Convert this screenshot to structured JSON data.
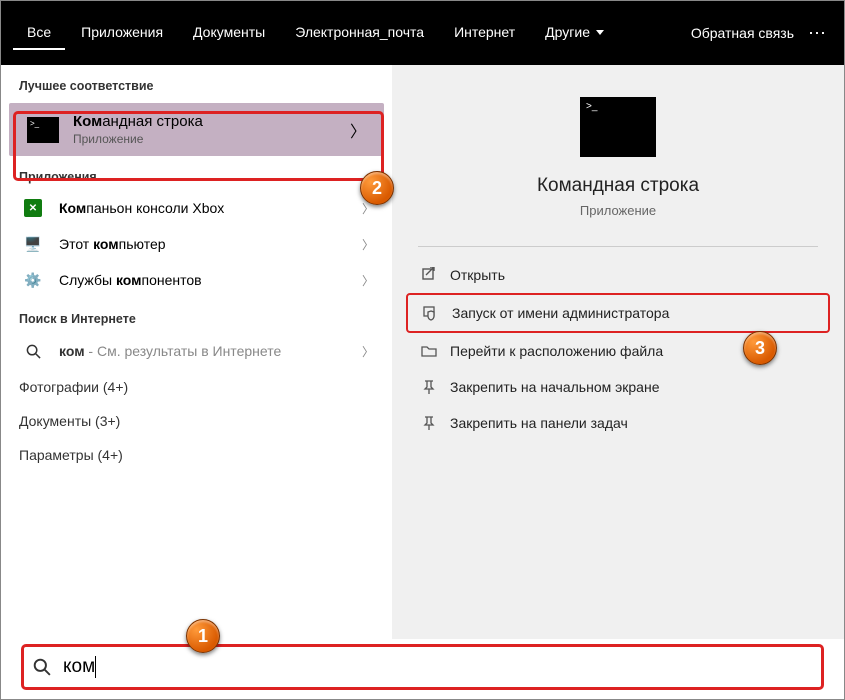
{
  "topbar": {
    "tabs": [
      "Все",
      "Приложения",
      "Документы",
      "Электронная_почта",
      "Интернет",
      "Другие"
    ],
    "active_tab": 0,
    "more_has_chevron": true,
    "feedback_label": "Обратная связь"
  },
  "results": {
    "best_header": "Лучшее соответствие",
    "best": {
      "title_bold": "Ком",
      "title_rest": "андная строка",
      "subtitle": "Приложение"
    },
    "apps_header": "Приложения",
    "apps": [
      {
        "icon": "xbox",
        "bold": "Ком",
        "rest": "паньон консоли Xbox"
      },
      {
        "icon": "pc",
        "pre": "Этот ",
        "bold": "ком",
        "post": "пьютер"
      },
      {
        "icon": "svc",
        "pre": "Службы ",
        "bold": "ком",
        "post": "понентов"
      }
    ],
    "web_header": "Поиск в Интернете",
    "web": {
      "bold": "ком",
      "rest": " - См. результаты в Интернете"
    },
    "categories": [
      "Фотографии (4+)",
      "Документы (3+)",
      "Параметры (4+)"
    ]
  },
  "preview": {
    "title": "Командная строка",
    "subtitle": "Приложение",
    "actions": [
      {
        "id": "open",
        "icon": "open",
        "label": "Открыть"
      },
      {
        "id": "admin",
        "icon": "shield",
        "label": "Запуск от имени администратора"
      },
      {
        "id": "loc",
        "icon": "folder",
        "label": "Перейти к расположению файла"
      },
      {
        "id": "pin-start",
        "icon": "pin",
        "label": "Закрепить на начальном экране"
      },
      {
        "id": "pin-task",
        "icon": "pin",
        "label": "Закрепить на панели задач"
      }
    ]
  },
  "search": {
    "value": "ком"
  },
  "annotations": {
    "b1": "1",
    "b2": "2",
    "b3": "3"
  }
}
